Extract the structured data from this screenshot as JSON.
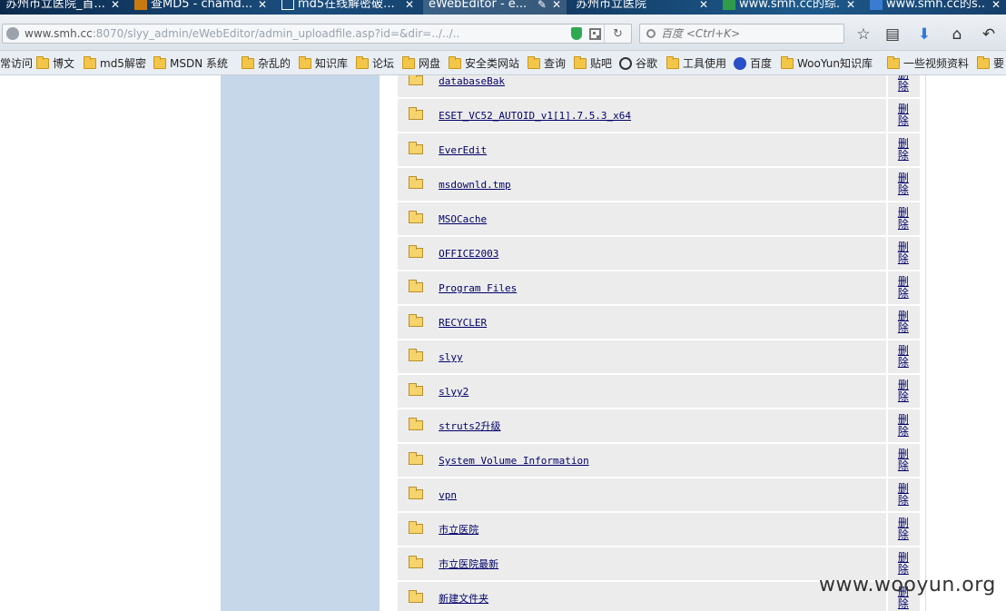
{
  "tabs": [
    {
      "title": "苏州市立医院_首...",
      "favicon_color": "#2b5b8a"
    },
    {
      "title": "查MD5 - chamd...",
      "favicon_color": "#c87a10"
    },
    {
      "title": "md5在线解密破...",
      "favicon_color": "#ffffff"
    },
    {
      "title": "eWebEditor - e...",
      "favicon_color": "#e06d0a"
    },
    {
      "title": "苏州市立医院",
      "favicon_color": "#2b5b8a"
    },
    {
      "title": "www.smh.cc的综...",
      "favicon_color": "#2e9c4a"
    },
    {
      "title": "www.smh.cc的s...",
      "favicon_color": "#3b7bd1"
    }
  ],
  "address": {
    "url_host": "www.smh.cc",
    "url_rest": ":8070/slyy_admin/eWebEditor/admin_uploadfile.asp?id=&dir=../../.."
  },
  "search": {
    "placeholder": "百度 <Ctrl+K>"
  },
  "bookmarks": [
    {
      "label": "常访问",
      "icon": "none"
    },
    {
      "label": "博文",
      "icon": "folder-icon"
    },
    {
      "label": "md5解密",
      "icon": "folder-icon"
    },
    {
      "label": "MSDN  系统",
      "icon": "folder-icon"
    },
    {
      "label": "杂乱的",
      "icon": "folder-icon"
    },
    {
      "label": "知识库",
      "icon": "folder-icon"
    },
    {
      "label": "论坛",
      "icon": "folder-icon"
    },
    {
      "label": "网盘",
      "icon": "folder-icon"
    },
    {
      "label": "安全类网站",
      "icon": "folder-icon"
    },
    {
      "label": "查询",
      "icon": "folder-icon"
    },
    {
      "label": "贴吧",
      "icon": "folder-icon"
    },
    {
      "label": "谷歌",
      "icon": "google-icon"
    },
    {
      "label": "工具使用",
      "icon": "folder-icon"
    },
    {
      "label": "百度",
      "icon": "baidu-icon"
    },
    {
      "label": "WooYun知识库",
      "icon": "folder-icon"
    },
    {
      "label": "一些视频资料",
      "icon": "folder-icon"
    },
    {
      "label": "要",
      "icon": "folder-icon"
    }
  ],
  "files": [
    {
      "name": "databaseBak",
      "action": "删除"
    },
    {
      "name": "ESET_VC52_AUTOID_v1[1].7.5.3_x64",
      "action": "删除"
    },
    {
      "name": "EverEdit",
      "action": "删除"
    },
    {
      "name": "msdownld.tmp",
      "action": "删除"
    },
    {
      "name": "MSOCache",
      "action": "删除"
    },
    {
      "name": "OFFICE2003",
      "action": "删除"
    },
    {
      "name": "Program Files",
      "action": "删除"
    },
    {
      "name": "RECYCLER",
      "action": "删除"
    },
    {
      "name": "slyy",
      "action": "删除"
    },
    {
      "name": "slyy2",
      "action": "删除"
    },
    {
      "name": "struts2升级",
      "action": "删除"
    },
    {
      "name": "System Volume Information",
      "action": "删除"
    },
    {
      "name": "vpn",
      "action": "删除"
    },
    {
      "name": "市立医院",
      "action": "删除"
    },
    {
      "name": "市立医院最新",
      "action": "删除"
    },
    {
      "name": "新建文件夹",
      "action": "删除"
    }
  ],
  "watermark": "www.wooyun.org",
  "colors": {
    "link": "#00006a",
    "row_bg": "#ececec",
    "sidebar_bg": "#c5d7e8"
  }
}
